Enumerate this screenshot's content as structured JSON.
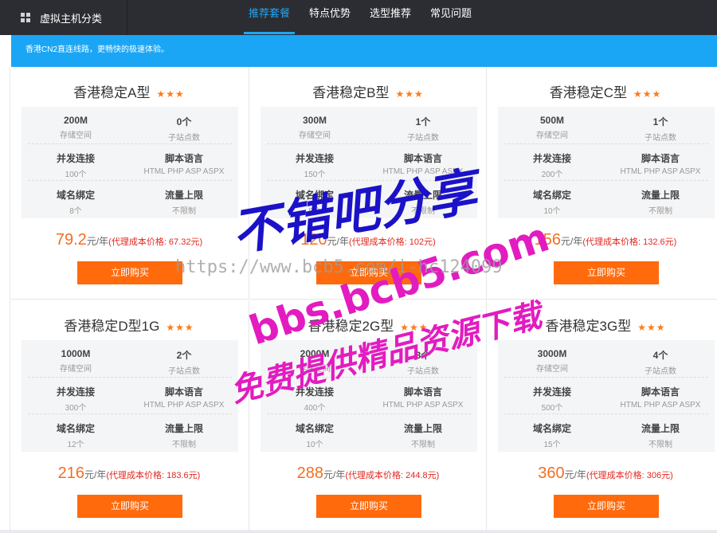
{
  "header": {
    "category_label": "虚拟主机分类",
    "tabs": [
      {
        "label": "推荐套餐",
        "active": true
      },
      {
        "label": "特点优势",
        "active": false
      },
      {
        "label": "选型推荐",
        "active": false
      },
      {
        "label": "常见问题",
        "active": false
      }
    ]
  },
  "banner": {
    "text": "香港CN2直连线路，更畅快的极速体验。"
  },
  "spec_labels": {
    "storage": "存储空间",
    "sites": "子站点数",
    "conn": "并发连接",
    "script": "脚本语言",
    "domain": "域名绑定",
    "traffic": "流量上限"
  },
  "colors": {
    "accent_blue": "#1aa6f5",
    "price_orange": "#f26f23",
    "buy_button": "#ff6a0c",
    "agent_red": "#e2281f",
    "star": "#ff7a17"
  },
  "price_unit": "元/年",
  "buy_label": "立即购买",
  "plans": [
    {
      "name": "香港稳定A型",
      "stars": "★★★",
      "storage": "200M",
      "sites": "0个",
      "conn": "并发连接",
      "conn_val": "100个",
      "script": "脚本语言",
      "script_val": "HTML PHP ASP ASPX",
      "domain": "域名绑定",
      "domain_val": "8个",
      "traffic": "流量上限",
      "traffic_val": "不限制",
      "price": "79.2",
      "agent_price": "(代理成本价格: 67.32元)"
    },
    {
      "name": "香港稳定B型",
      "stars": "★★★",
      "storage": "300M",
      "sites": "1个",
      "conn": "并发连接",
      "conn_val": "150个",
      "script": "脚本语言",
      "script_val": "HTML PHP ASP ASPX",
      "domain": "域名绑定",
      "domain_val": "8个",
      "traffic": "流量上限",
      "traffic_val": "不限制",
      "price": "120",
      "agent_price": "(代理成本价格: 102元)"
    },
    {
      "name": "香港稳定C型",
      "stars": "★★★",
      "storage": "500M",
      "sites": "1个",
      "conn": "并发连接",
      "conn_val": "200个",
      "script": "脚本语言",
      "script_val": "HTML PHP ASP ASPX",
      "domain": "域名绑定",
      "domain_val": "10个",
      "traffic": "流量上限",
      "traffic_val": "不限制",
      "price": "156",
      "agent_price": "(代理成本价格: 132.6元)"
    },
    {
      "name": "香港稳定D型1G",
      "stars": "★★★",
      "storage": "1000M",
      "sites": "2个",
      "conn": "并发连接",
      "conn_val": "300个",
      "script": "脚本语言",
      "script_val": "HTML PHP ASP ASPX",
      "domain": "域名绑定",
      "domain_val": "12个",
      "traffic": "流量上限",
      "traffic_val": "不限制",
      "price": "216",
      "agent_price": "(代理成本价格: 183.6元)"
    },
    {
      "name": "香港稳定2G型",
      "stars": "★★★",
      "storage": "2000M",
      "sites": "3个",
      "conn": "并发连接",
      "conn_val": "400个",
      "script": "脚本语言",
      "script_val": "HTML PHP ASP ASPX",
      "domain": "域名绑定",
      "domain_val": "10个",
      "traffic": "流量上限",
      "traffic_val": "不限制",
      "price": "288",
      "agent_price": "(代理成本价格: 244.8元)"
    },
    {
      "name": "香港稳定3G型",
      "stars": "★★★",
      "storage": "3000M",
      "sites": "4个",
      "conn": "并发连接",
      "conn_val": "500个",
      "script": "脚本语言",
      "script_val": "HTML PHP ASP ASPX",
      "domain": "域名绑定",
      "domain_val": "15个",
      "traffic": "流量上限",
      "traffic_val": "不限制",
      "price": "360",
      "agent_price": "(代理成本价格: 306元)"
    }
  ],
  "watermark": {
    "line1": "不错吧分享",
    "line2": "bbs.bcb5.com",
    "url": "https://www.bcb5.com/i-hc124099",
    "line3": "免费提供精品资源下载"
  }
}
